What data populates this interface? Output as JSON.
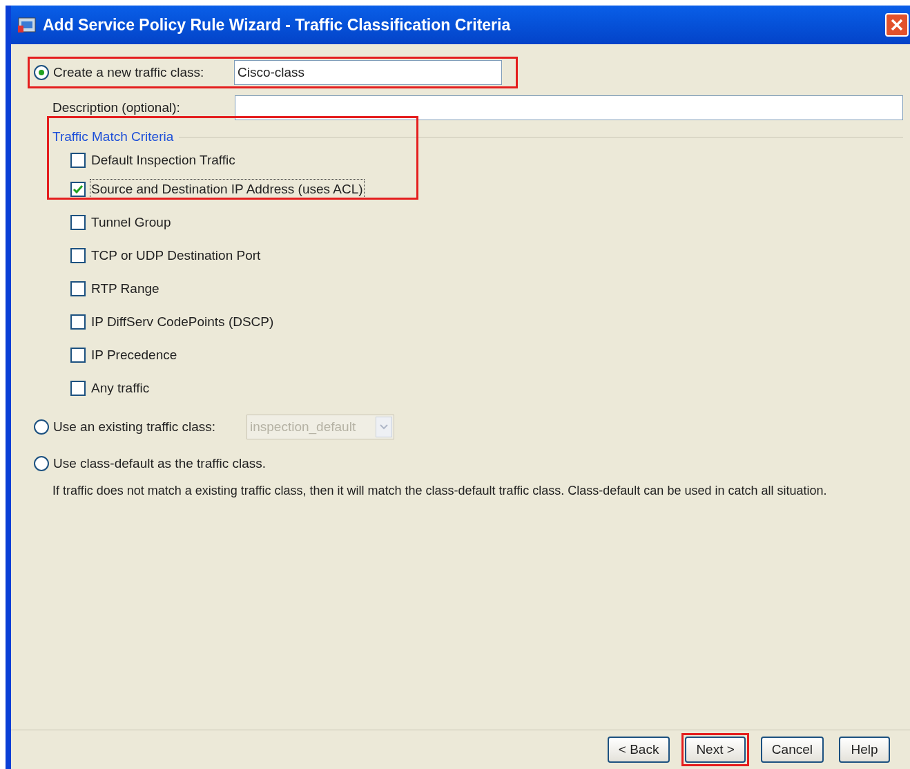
{
  "window": {
    "title": "Add Service Policy Rule Wizard - Traffic Classification Criteria"
  },
  "new_class": {
    "label": "Create a new traffic class:",
    "selected": true,
    "value": "Cisco-class",
    "highlighted": true
  },
  "description": {
    "label": "Description (optional):"
  },
  "criteria": {
    "title": "Traffic Match Criteria",
    "highlighted": true,
    "items": [
      {
        "label": "Default Inspection Traffic",
        "checked": false,
        "focused": false
      },
      {
        "label": "Source and Destination IP Address (uses ACL)",
        "checked": true,
        "focused": true
      },
      {
        "label": "Tunnel Group",
        "checked": false,
        "focused": false
      },
      {
        "label": "TCP or UDP Destination Port",
        "checked": false,
        "focused": false
      },
      {
        "label": "RTP Range",
        "checked": false,
        "focused": false
      },
      {
        "label": "IP DiffServ CodePoints (DSCP)",
        "checked": false,
        "focused": false
      },
      {
        "label": "IP Precedence",
        "checked": false,
        "focused": false
      },
      {
        "label": "Any traffic",
        "checked": false,
        "focused": false
      }
    ]
  },
  "existing_class": {
    "label": "Use an existing traffic class:",
    "selected": false,
    "value": "inspection_default",
    "disabled": true
  },
  "class_default": {
    "label": "Use class-default as the traffic class.",
    "selected": false
  },
  "note": "If traffic does not match a existing traffic class, then it will match the class-default traffic class. Class-default can be used in catch all situation.",
  "buttons": [
    {
      "label": "< Back",
      "highlighted": false
    },
    {
      "label": "Next >",
      "highlighted": true
    },
    {
      "label": "Cancel",
      "highlighted": false
    },
    {
      "label": "Help",
      "highlighted": false
    }
  ]
}
